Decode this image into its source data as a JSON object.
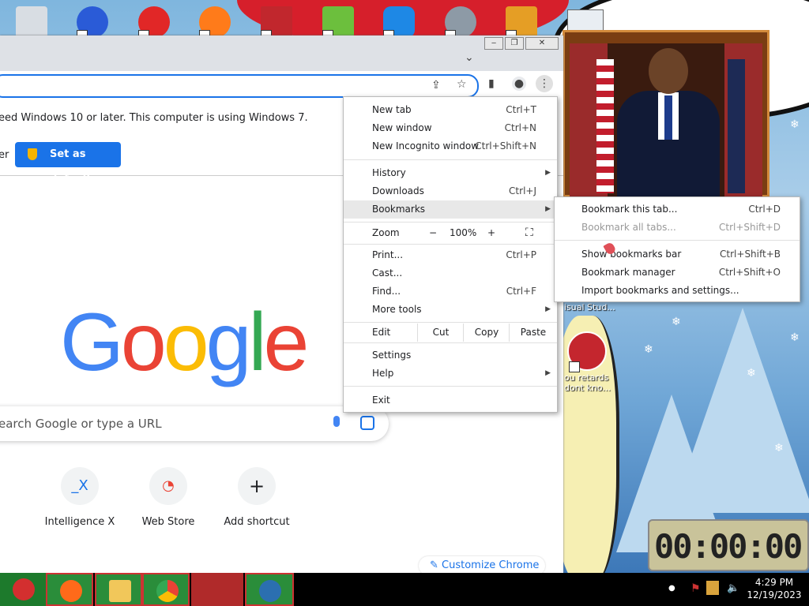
{
  "desktop": {
    "icons_top": [
      "Recycle Bin",
      "2",
      "Red ball",
      "Firefox",
      "Gate",
      "Notepad",
      "Remote",
      "Shark",
      "Game"
    ],
    "icon_labels": [
      "isual Stud...",
      "ou retards dont kno..."
    ]
  },
  "timer": {
    "display": "00:00:00"
  },
  "chrome": {
    "window_controls": {
      "minimize": "‒",
      "restore": "❐",
      "close": "✕"
    },
    "infobar": {
      "message": "eed Windows 10 or later. This computer is using Windows 7.",
      "left_fragment": "er",
      "set_default_label": "Set as default"
    },
    "logo": [
      "G",
      "o",
      "o",
      "g",
      "l",
      "e"
    ],
    "search_placeholder": "earch Google or type a URL",
    "shortcuts": [
      {
        "label": "Intelligence X",
        "glyph": "_X"
      },
      {
        "label": "Web Store",
        "glyph": "◔"
      },
      {
        "label": "Add shortcut",
        "glyph": "+"
      }
    ],
    "customize_label": "Customize Chrome"
  },
  "menu": {
    "new_tab": {
      "label": "New tab",
      "shortcut": "Ctrl+T"
    },
    "new_window": {
      "label": "New window",
      "shortcut": "Ctrl+N"
    },
    "new_incognito": {
      "label": "New Incognito window",
      "shortcut": "Ctrl+Shift+N"
    },
    "history": {
      "label": "History"
    },
    "downloads": {
      "label": "Downloads",
      "shortcut": "Ctrl+J"
    },
    "bookmarks": {
      "label": "Bookmarks"
    },
    "zoom": {
      "label": "Zoom",
      "minus": "−",
      "value": "100%",
      "plus": "+"
    },
    "print": {
      "label": "Print...",
      "shortcut": "Ctrl+P"
    },
    "cast": {
      "label": "Cast..."
    },
    "find": {
      "label": "Find...",
      "shortcut": "Ctrl+F"
    },
    "more_tools": {
      "label": "More tools"
    },
    "edit": {
      "label": "Edit",
      "cut": "Cut",
      "copy": "Copy",
      "paste": "Paste"
    },
    "settings": {
      "label": "Settings"
    },
    "help": {
      "label": "Help"
    },
    "exit": {
      "label": "Exit"
    }
  },
  "bookmarks_submenu": [
    {
      "label": "Bookmark this tab...",
      "shortcut": "Ctrl+D",
      "disabled": false
    },
    {
      "label": "Bookmark all tabs...",
      "shortcut": "Ctrl+Shift+D",
      "disabled": true
    },
    {
      "label": "Show bookmarks bar",
      "shortcut": "Ctrl+Shift+B",
      "disabled": false
    },
    {
      "label": "Bookmark manager",
      "shortcut": "Ctrl+Shift+O",
      "disabled": false
    },
    {
      "label": "Import bookmarks and settings...",
      "shortcut": "",
      "disabled": false
    }
  ],
  "taskbar": {
    "apps": [
      "Start",
      "Firefox",
      "File Explorer",
      "Chrome",
      "App",
      "Globe"
    ],
    "clock_time": "4:29 PM",
    "clock_date": "12/19/2023"
  },
  "colors": {
    "accent": "#1a73e8",
    "g_blue": "#4285f4",
    "g_red": "#ea4335",
    "g_yellow": "#fbbc05",
    "g_green": "#34a853"
  }
}
